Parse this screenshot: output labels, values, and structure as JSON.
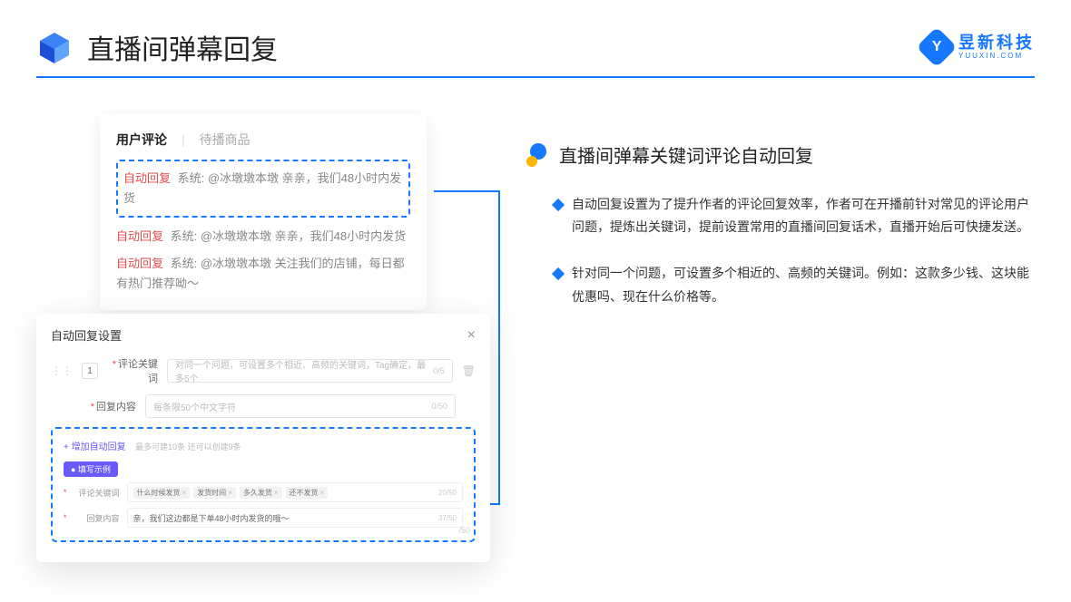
{
  "header": {
    "title": "直播间弹幕回复",
    "logo_cn": "昱新科技",
    "logo_en": "YUUXIN.COM",
    "logo_letter": "Y"
  },
  "comments": {
    "tab_active": "用户评论",
    "tab_inactive": "待播商品",
    "highlighted": {
      "tag": "自动回复",
      "text": "系统: @冰墩墩本墩 亲亲，我们48小时内发货"
    },
    "rows": [
      {
        "tag": "自动回复",
        "text": "系统: @冰墩墩本墩 亲亲，我们48小时内发货"
      },
      {
        "tag": "自动回复",
        "text": "系统: @冰墩墩本墩 关注我们的店铺，每日都有热门推荐呦～"
      }
    ]
  },
  "modal": {
    "title": "自动回复设置",
    "num": "1",
    "kw_label": "评论关键词",
    "kw_placeholder": "对同一个问题，可设置多个相近、高频的关键词，Tag确定，最多5个",
    "kw_count": "0/5",
    "content_label": "回复内容",
    "content_placeholder": "每条限50个中文字符",
    "content_count": "0/50",
    "add_link": "+ 增加自动回复",
    "add_hint": "最多可建10条 还可以创建9条",
    "example_badge": "● 填写示例",
    "ex_kw_label": "评论关键词",
    "ex_tags": [
      "什么时候发货",
      "发货时间",
      "多久发货",
      "还不发货"
    ],
    "ex_kw_count": "20/50",
    "ex_content_label": "回复内容",
    "ex_content_value": "亲，我们这边都是下单48小时内发货的哦～",
    "ex_content_count": "37/50",
    "extra_count": "/50"
  },
  "right": {
    "title": "直播间弹幕关键词评论自动回复",
    "bullets": [
      "自动回复设置为了提升作者的评论回复效率，作者可在开播前针对常见的评论用户问题，提炼出关键词，提前设置常用的直播间回复话术，直播开始后可快捷发送。",
      "针对同一个问题，可设置多个相近的、高频的关键词。例如：这款多少钱、这块能优惠吗、现在什么价格等。"
    ]
  }
}
